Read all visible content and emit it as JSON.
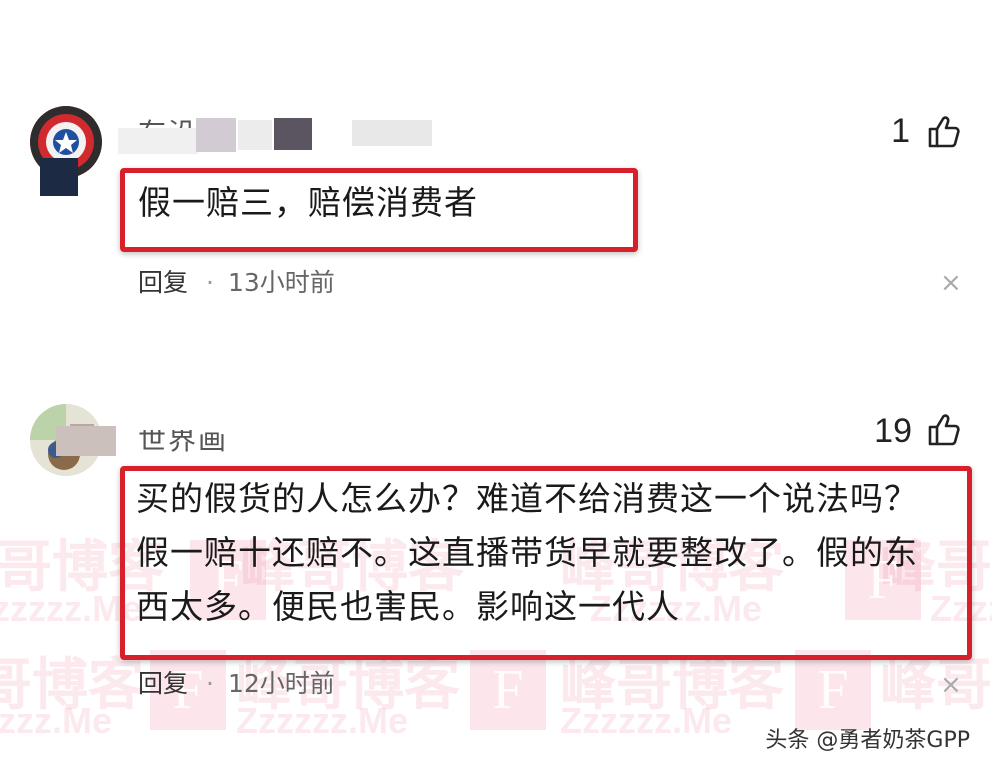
{
  "comments": [
    {
      "username": "有沿",
      "likes": "1",
      "content": "假一赔三，赔偿消费者",
      "reply_label": "回复",
      "separator": "·",
      "time": "13小时前",
      "close": "×"
    },
    {
      "username": "世界画",
      "likes": "19",
      "content_lines": [
        "买的假货的人怎么办？难道不给消费这一个说法吗？",
        "假一赔十还赔不。这直播带货早就要整改了。假的东",
        "西太多。便民也害民。影响这一代人"
      ],
      "reply_label": "回复",
      "separator": "·",
      "time": "12小时前",
      "close": "×"
    }
  ],
  "watermark": {
    "brand": "峰哥博客",
    "domain": "Zzzzzz.Me",
    "letter": "F"
  },
  "footer": {
    "label": "头条 @勇者奶茶GPP"
  },
  "colors": {
    "highlight_border": "#d8202c",
    "watermark": "#e6466e"
  },
  "icons": [
    "thumbs-up-icon",
    "close-icon",
    "captain-shield-avatar"
  ]
}
